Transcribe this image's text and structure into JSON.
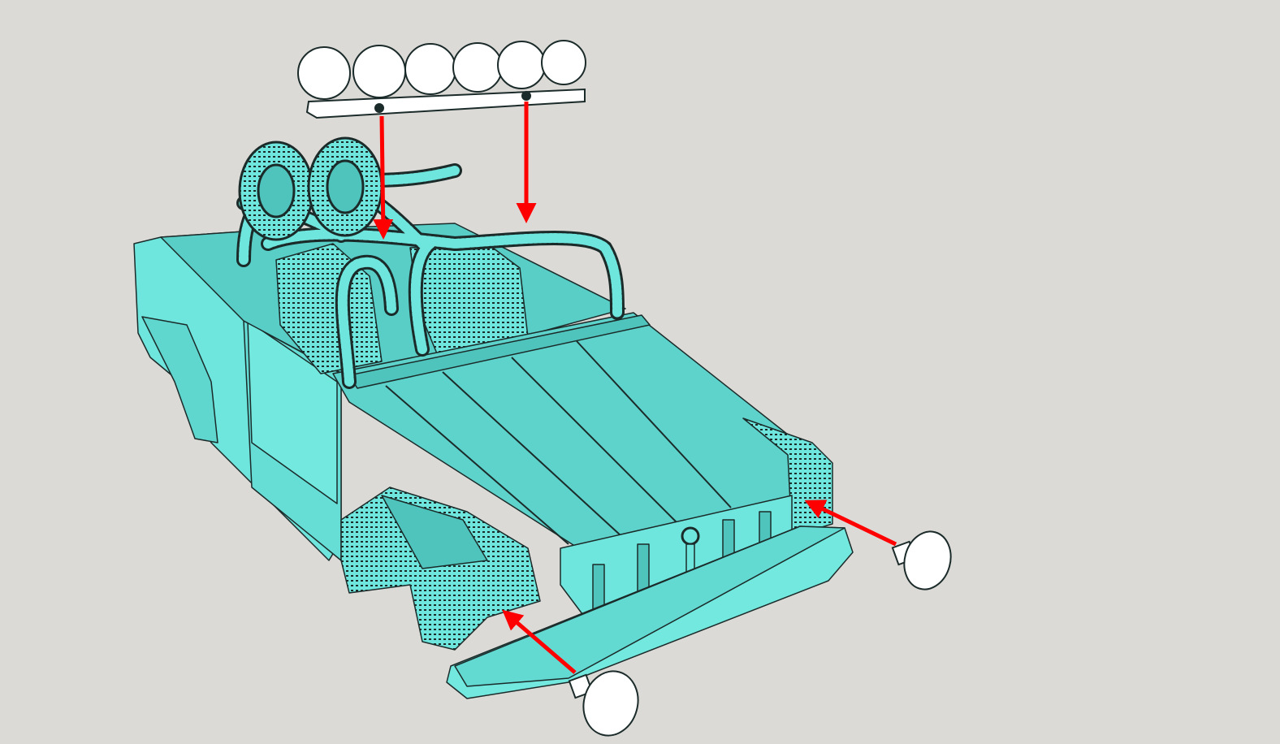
{
  "scene": {
    "background_color": "#dcdad6",
    "model_color": "#6fe6dd",
    "model_shadow_color": "#4fc4bc",
    "edge_color": "#1b2b2a",
    "part_color": "#ffffff",
    "arrow_color": "#ff0000"
  },
  "parts": [
    {
      "name": "roof-light-bar",
      "lamp_count": 6
    },
    {
      "name": "right-fog-light",
      "lamp_count": 1
    },
    {
      "name": "left-fog-light",
      "lamp_count": 1
    }
  ],
  "arrows": [
    {
      "name": "light-bar-mount-arrow-left"
    },
    {
      "name": "light-bar-mount-arrow-right"
    },
    {
      "name": "right-fog-light-arrow"
    },
    {
      "name": "left-fog-light-arrow"
    }
  ]
}
